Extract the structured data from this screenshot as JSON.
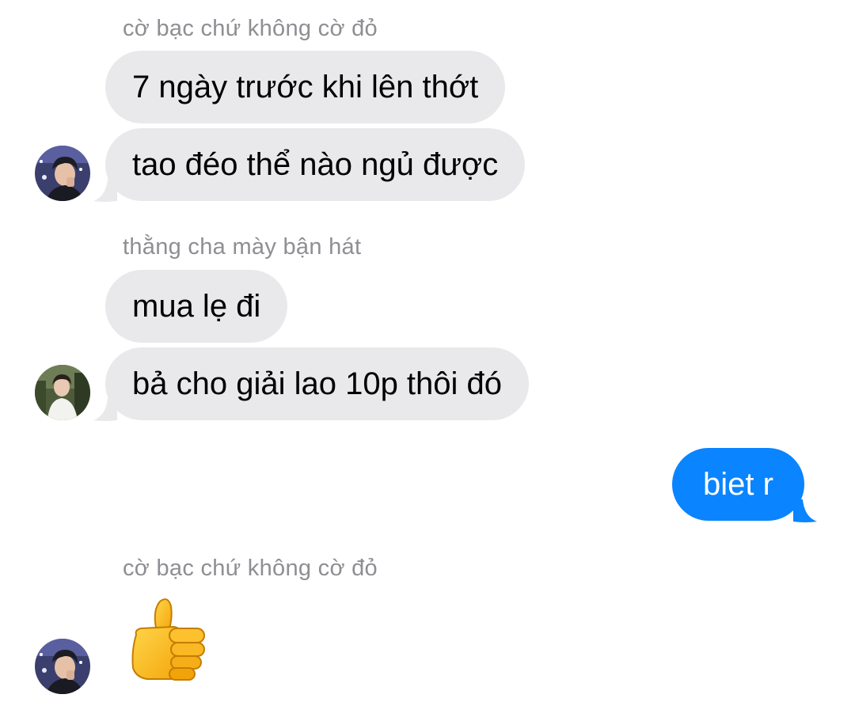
{
  "conversation": {
    "groups": [
      {
        "sender": "cờ bạc chứ không cờ đỏ",
        "messages": [
          "7 ngày trước khi lên thớt",
          "tao đéo thể nào ngủ được"
        ]
      },
      {
        "sender": "thằng cha mày bận hát",
        "messages": [
          "mua lẹ đi",
          "bả cho giải lao 10p thôi đó"
        ]
      },
      {
        "sender": "cờ bạc chứ không cờ đỏ",
        "reaction_emoji": "thumbs-up"
      }
    ],
    "outgoing": {
      "message": "biet r"
    }
  },
  "colors": {
    "incoming_bubble": "#e9e9eb",
    "outgoing_bubble": "#0a84ff",
    "sender_name": "#8e8e93"
  }
}
